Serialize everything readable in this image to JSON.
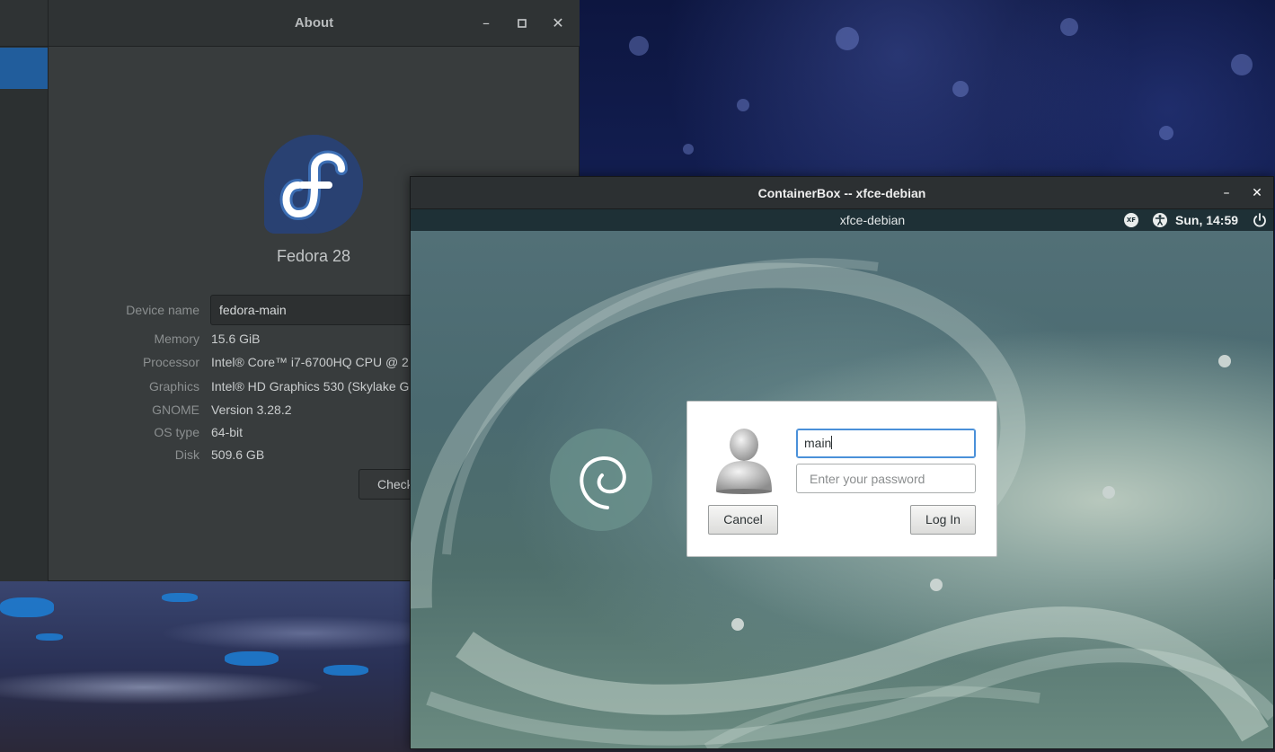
{
  "about_window": {
    "title": "About",
    "controls": {
      "minimize": "–",
      "maximize": "▫",
      "close": "✕"
    },
    "os_name": "Fedora 28",
    "device_name_label": "Device name",
    "device_name_value": "fedora-main",
    "info": [
      {
        "label": "Memory",
        "value": "15.6 GiB"
      },
      {
        "label": "Processor",
        "value": "Intel® Core™ i7-6700HQ CPU @ 2."
      },
      {
        "label": "Graphics",
        "value": "Intel® HD Graphics 530 (Skylake G"
      },
      {
        "label": "GNOME",
        "value": "Version 3.28.2"
      },
      {
        "label": "OS type",
        "value": "64-bit"
      },
      {
        "label": "Disk",
        "value": "509.6 GB"
      }
    ],
    "check_button": "Check"
  },
  "containerbox_window": {
    "title": "ContainerBox -- xfce-debian",
    "controls": {
      "minimize": "–",
      "close": "✕"
    },
    "panel": {
      "hostname": "xfce-debian",
      "xfce_icon": "XF",
      "clock": "Sun, 14:59",
      "icons": [
        "xfce-icon",
        "accessibility-icon",
        "power-icon"
      ]
    },
    "login": {
      "username_value": "main",
      "password_placeholder": "Enter your password",
      "cancel_label": "Cancel",
      "login_label": "Log In"
    }
  },
  "colors": {
    "selection_blue": "#215d9c",
    "input_focus": "#4a90d9",
    "fedora_blue": "#294172",
    "fedora_light": "#3c6eb4"
  }
}
